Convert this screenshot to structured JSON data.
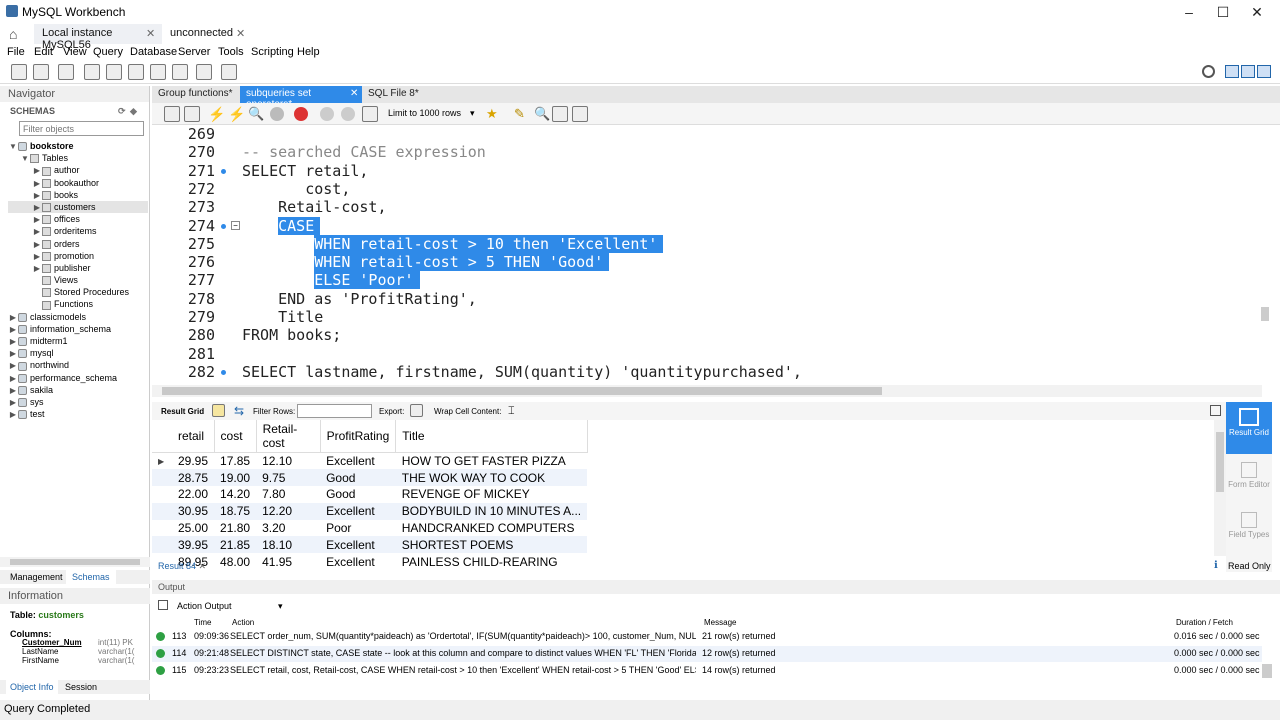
{
  "window": {
    "title": "MySQL Workbench"
  },
  "connection_tabs": [
    "Local instance MySQL56",
    "unconnected"
  ],
  "menu": [
    "File",
    "Edit",
    "View",
    "Query",
    "Database",
    "Server",
    "Tools",
    "Scripting",
    "Help"
  ],
  "navigator": {
    "header": "Navigator",
    "schemas_label": "SCHEMAS",
    "filter_placeholder": "Filter objects",
    "tree": {
      "db": "bookstore",
      "tables_label": "Tables",
      "tables": [
        "author",
        "bookauthor",
        "books",
        "customers",
        "offices",
        "orderitems",
        "orders",
        "promotion",
        "publisher"
      ],
      "views": "Views",
      "procs": "Stored Procedures",
      "funcs": "Functions",
      "others": [
        "classicmodels",
        "information_schema",
        "midterm1",
        "mysql",
        "northwind",
        "performance_schema",
        "sakila",
        "sys",
        "test"
      ]
    },
    "bottom_tabs": [
      "Management",
      "Schemas"
    ],
    "info_header": "Information",
    "info_table_label": "Table:",
    "info_table": "customers",
    "columns_label": "Columns:",
    "columns": [
      {
        "name": "Customer_Num",
        "type": "int(11) PK"
      },
      {
        "name": "LastName",
        "type": "varchar(1("
      },
      {
        "name": "FirstName",
        "type": "varchar(1("
      }
    ],
    "info_tabs": [
      "Object Info",
      "Session"
    ]
  },
  "sql_tabs": [
    "Group functions*",
    "subqueries set operators*",
    "SQL File 8*"
  ],
  "editor_toolbar": {
    "limit": "Limit to 1000 rows"
  },
  "editor": {
    "lines": [
      {
        "n": "269",
        "t": ""
      },
      {
        "n": "270",
        "t": "-- searched CASE expression"
      },
      {
        "n": "271",
        "t": "SELECT retail,"
      },
      {
        "n": "272",
        "t": "       cost,"
      },
      {
        "n": "273",
        "t": "    Retail-cost,"
      },
      {
        "n": "274",
        "t": "CASE"
      },
      {
        "n": "275",
        "t": "WHEN retail-cost > 10 then 'Excellent'"
      },
      {
        "n": "276",
        "t": "WHEN retail-cost > 5 THEN 'Good'"
      },
      {
        "n": "277",
        "t": "ELSE 'Poor'"
      },
      {
        "n": "278",
        "t": "    END as 'ProfitRating',"
      },
      {
        "n": "279",
        "t": "    Title"
      },
      {
        "n": "280",
        "t": "FROM books;"
      },
      {
        "n": "281",
        "t": ""
      },
      {
        "n": "282",
        "t": "SELECT lastname, firstname, SUM(quantity) 'quantitypurchased',"
      }
    ]
  },
  "result_toolbar": {
    "result_grid": "Result Grid",
    "filter_rows": "Filter Rows:",
    "export": "Export:",
    "wrap": "Wrap Cell Content:"
  },
  "grid": {
    "columns": [
      "retail",
      "cost",
      "Retail-cost",
      "ProfitRating",
      "Title"
    ],
    "rows": [
      [
        "29.95",
        "17.85",
        "12.10",
        "Excellent",
        "HOW TO GET FASTER PIZZA"
      ],
      [
        "28.75",
        "19.00",
        "9.75",
        "Good",
        "THE WOK WAY TO COOK"
      ],
      [
        "22.00",
        "14.20",
        "7.80",
        "Good",
        "REVENGE OF MICKEY"
      ],
      [
        "30.95",
        "18.75",
        "12.20",
        "Excellent",
        "BODYBUILD IN 10 MINUTES A..."
      ],
      [
        "25.00",
        "21.80",
        "3.20",
        "Poor",
        "HANDCRANKED COMPUTERS"
      ],
      [
        "39.95",
        "21.85",
        "18.10",
        "Excellent",
        "SHORTEST POEMS"
      ],
      [
        "89.95",
        "48.00",
        "41.95",
        "Excellent",
        "PAINLESS CHILD-REARING"
      ]
    ]
  },
  "right_pane": [
    "Result Grid",
    "Form Editor",
    "Field Types"
  ],
  "result_tab": "Result 84",
  "read_only": "Read Only",
  "output": {
    "header": "Output",
    "selector": "Action Output",
    "cols": [
      "Time",
      "Action",
      "Message",
      "Duration / Fetch"
    ],
    "rows": [
      {
        "n": "113",
        "time": "09:09:36",
        "action": "SELECT order_num, SUM(quantity*paideach) as 'Ordertotal', IF(SUM(quantity*paideach)> 100, customer_Num, NULL) as 'Custo...",
        "msg": "21 row(s) returned",
        "dur": "0.016 sec / 0.000 sec"
      },
      {
        "n": "114",
        "time": "09:21:48",
        "action": "SELECT DISTINCT state, CASE state  -- look at this column and compare to distinct values WHEN 'FL' THEN 'Florida' WHEN '...",
        "msg": "12 row(s) returned",
        "dur": "0.000 sec / 0.000 sec"
      },
      {
        "n": "115",
        "time": "09:23:23",
        "action": "SELECT retail,  cost, Retail-cost, CASE WHEN retail-cost > 10 then 'Excellent' WHEN retail-cost > 5 THEN 'Good' ELSE 'Poor' ...",
        "msg": "14 row(s) returned",
        "dur": "0.000 sec / 0.000 sec"
      }
    ]
  },
  "status": "Query Completed"
}
